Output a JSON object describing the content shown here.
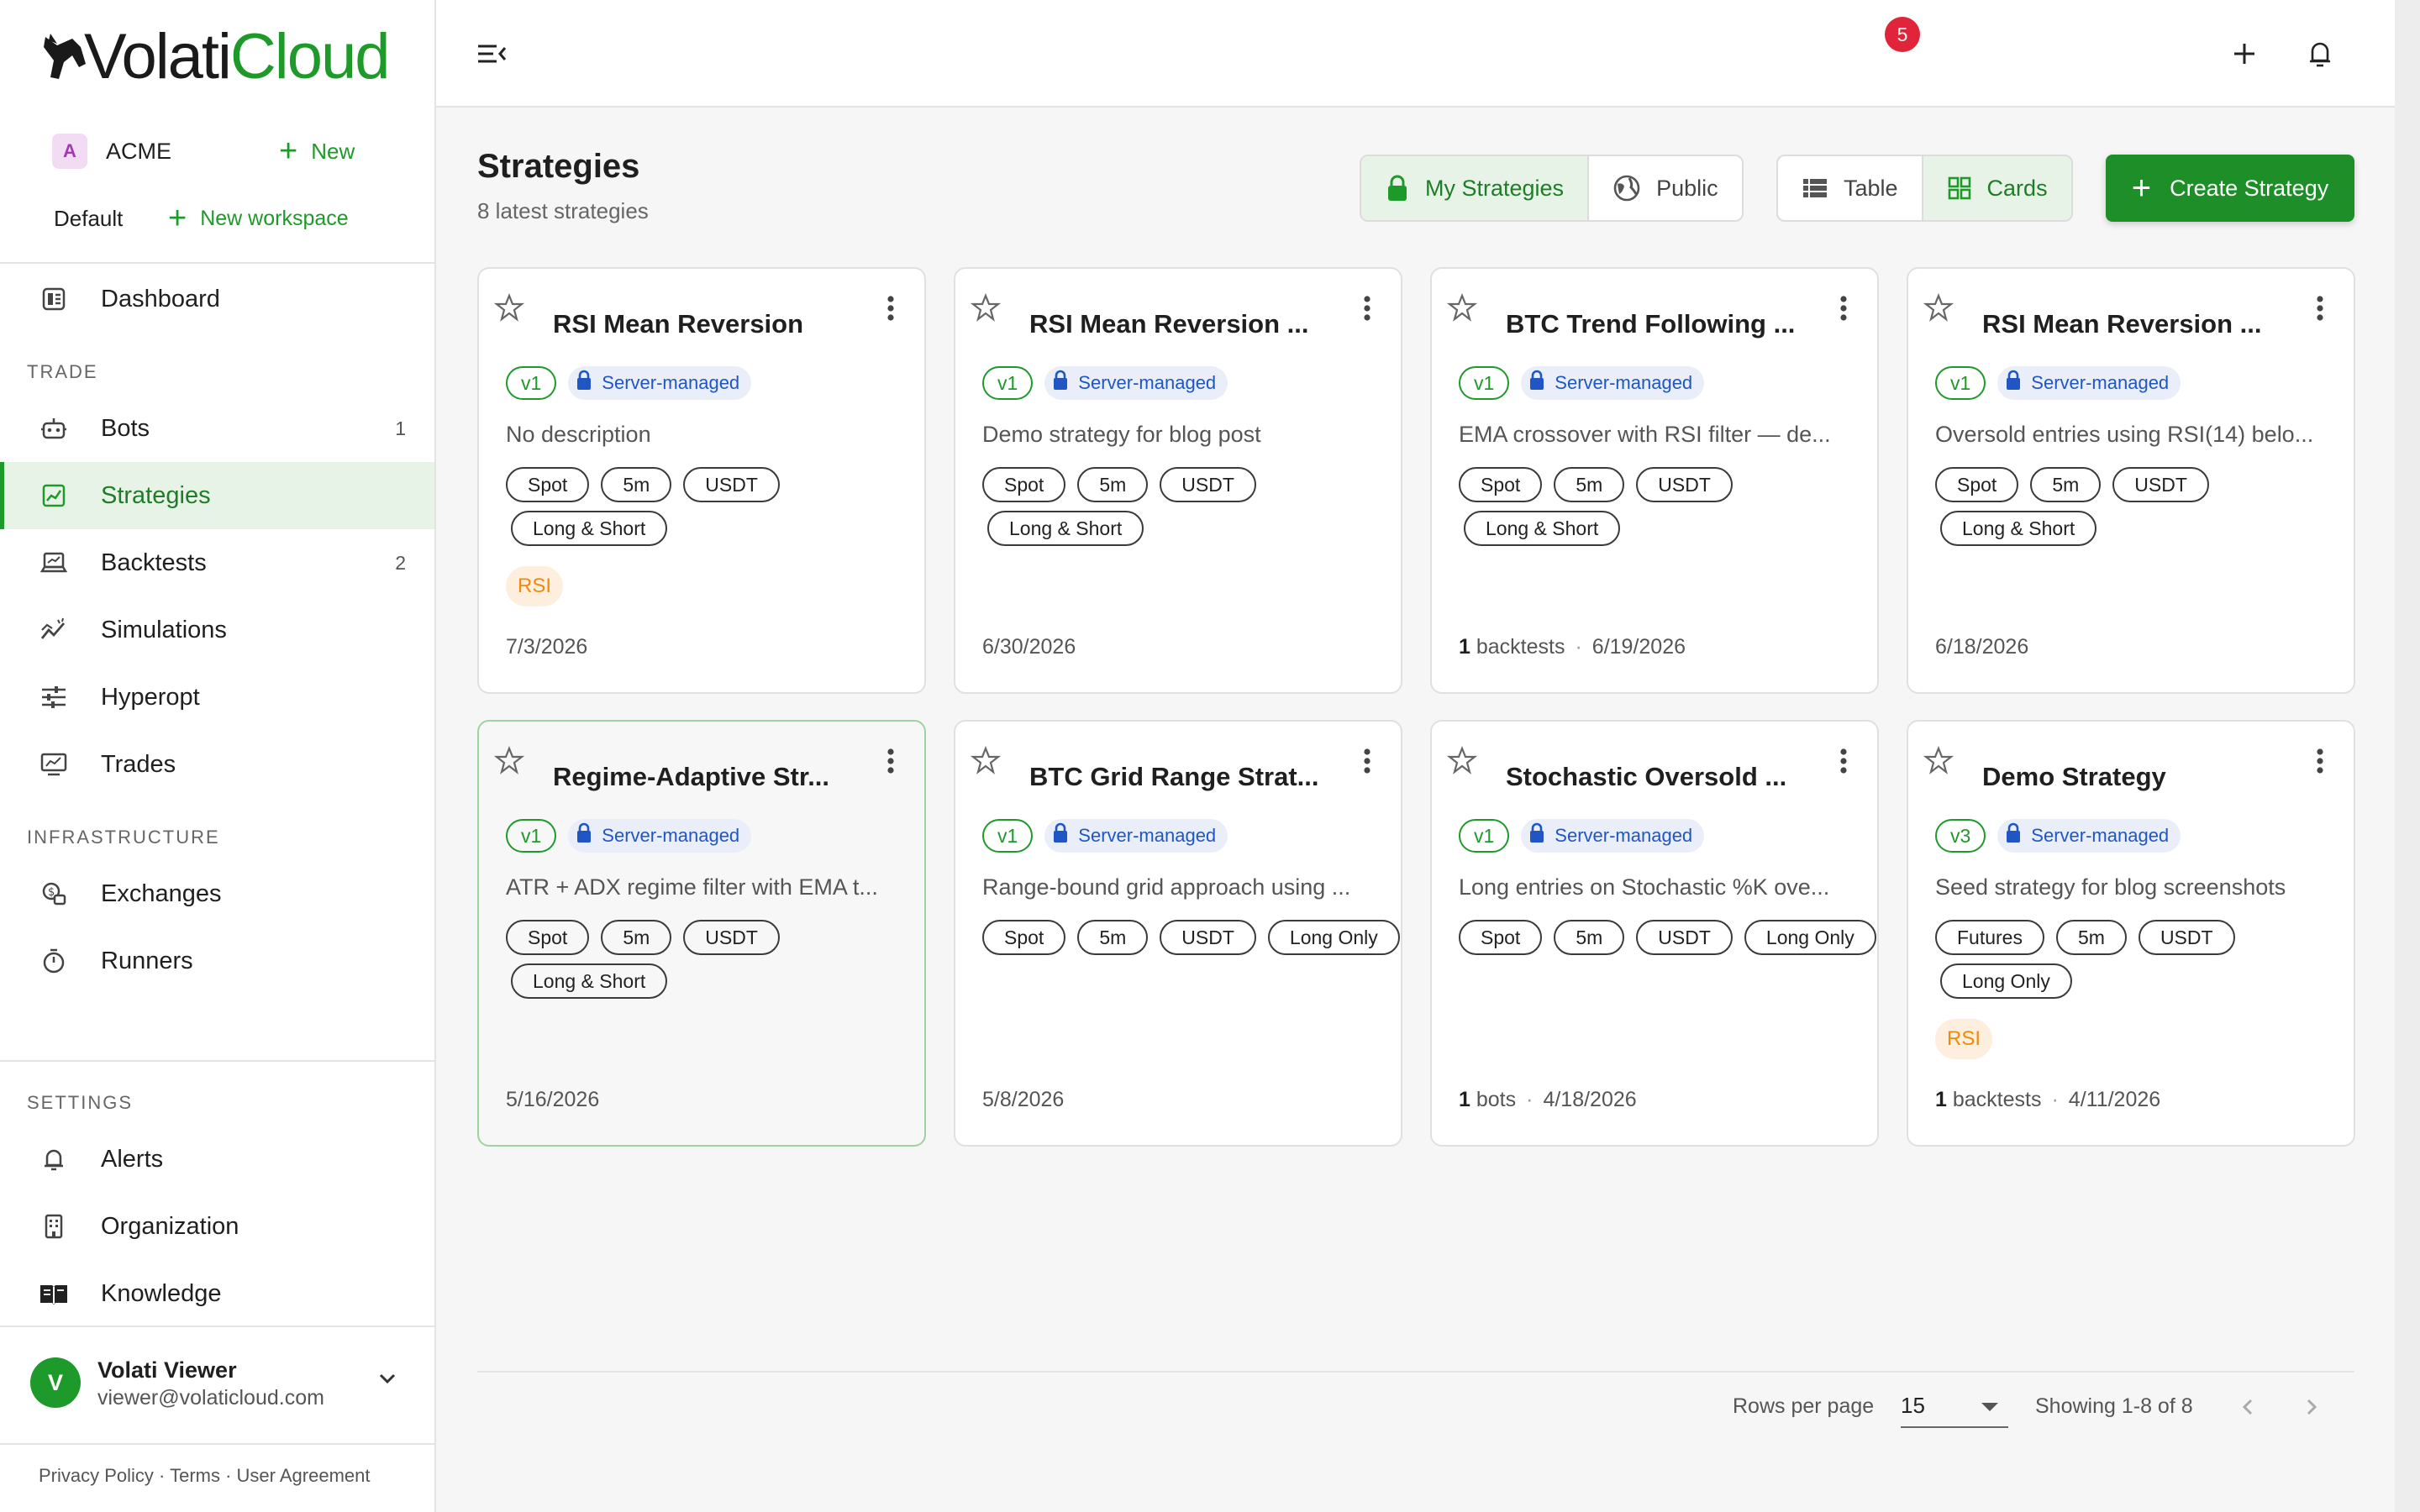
{
  "app": {
    "logo_main": "Volati",
    "logo_accent": "Cloud"
  },
  "sidebar": {
    "org": {
      "badge": "A",
      "name": "ACME",
      "new_label": "New"
    },
    "workspace": {
      "name": "Default",
      "new_label": "New workspace"
    },
    "dashboard_label": "Dashboard",
    "sections": {
      "trade": "TRADE",
      "infrastructure": "INFRASTRUCTURE",
      "settings": "SETTINGS"
    },
    "trade_items": [
      {
        "label": "Bots",
        "count": "1",
        "icon": "bot-icon"
      },
      {
        "label": "Strategies",
        "count": "",
        "icon": "strategy-icon",
        "active": true
      },
      {
        "label": "Backtests",
        "count": "2",
        "icon": "backtest-icon"
      },
      {
        "label": "Simulations",
        "count": "",
        "icon": "simulation-icon"
      },
      {
        "label": "Hyperopt",
        "count": "",
        "icon": "tune-icon"
      },
      {
        "label": "Trades",
        "count": "",
        "icon": "chart-icon"
      }
    ],
    "infra_items": [
      {
        "label": "Exchanges",
        "icon": "exchange-icon"
      },
      {
        "label": "Runners",
        "icon": "timer-icon"
      }
    ],
    "settings_items": [
      {
        "label": "Alerts",
        "icon": "bell-icon"
      },
      {
        "label": "Organization",
        "icon": "building-icon"
      },
      {
        "label": "Knowledge",
        "icon": "book-icon"
      }
    ],
    "user": {
      "initial": "V",
      "name": "Volati Viewer",
      "email": "viewer@volaticloud.com"
    },
    "footer": {
      "privacy": "Privacy Policy",
      "terms": "Terms",
      "agreement": "User Agreement",
      "sep": " · "
    }
  },
  "topbar": {
    "notification_count": "5"
  },
  "page": {
    "title": "Strategies",
    "subtitle": "8 latest strategies",
    "filter": {
      "mine": "My Strategies",
      "public": "Public"
    },
    "view": {
      "table": "Table",
      "cards": "Cards"
    },
    "create_label": "Create Strategy"
  },
  "strategies": [
    {
      "title": "RSI Mean Reversion",
      "version": "v1",
      "managed": "Server-managed",
      "description": "No description",
      "tags": [
        "Spot",
        "5m",
        "USDT",
        "Long & Short"
      ],
      "indicator": "RSI",
      "footer_count": "",
      "footer_unit": "",
      "date": "7/3/2026"
    },
    {
      "title": "RSI Mean Reversion ...",
      "version": "v1",
      "managed": "Server-managed",
      "description": "Demo strategy for blog post",
      "tags": [
        "Spot",
        "5m",
        "USDT",
        "Long & Short"
      ],
      "indicator": "",
      "footer_count": "",
      "footer_unit": "",
      "date": "6/30/2026"
    },
    {
      "title": "BTC Trend Following ...",
      "version": "v1",
      "managed": "Server-managed",
      "description": "EMA crossover with RSI filter — de...",
      "tags": [
        "Spot",
        "5m",
        "USDT",
        "Long & Short"
      ],
      "indicator": "",
      "footer_count": "1",
      "footer_unit": "backtests",
      "date": "6/19/2026"
    },
    {
      "title": "RSI Mean Reversion ...",
      "version": "v1",
      "managed": "Server-managed",
      "description": "Oversold entries using RSI(14) belo...",
      "tags": [
        "Spot",
        "5m",
        "USDT",
        "Long & Short"
      ],
      "indicator": "",
      "footer_count": "",
      "footer_unit": "",
      "date": "6/18/2026"
    },
    {
      "title": "Regime-Adaptive Str...",
      "version": "v1",
      "managed": "Server-managed",
      "description": "ATR + ADX regime filter with EMA t...",
      "tags": [
        "Spot",
        "5m",
        "USDT",
        "Long & Short"
      ],
      "indicator": "",
      "footer_count": "",
      "footer_unit": "",
      "date": "5/16/2026"
    },
    {
      "title": "BTC Grid Range Strat...",
      "version": "v1",
      "managed": "Server-managed",
      "description": "Range-bound grid approach using ...",
      "tags": [
        "Spot",
        "5m",
        "USDT",
        "Long Only"
      ],
      "indicator": "",
      "footer_count": "",
      "footer_unit": "",
      "date": "5/8/2026"
    },
    {
      "title": "Stochastic Oversold ...",
      "version": "v1",
      "managed": "Server-managed",
      "description": "Long entries on Stochastic %K ove...",
      "tags": [
        "Spot",
        "5m",
        "USDT",
        "Long Only"
      ],
      "indicator": "",
      "footer_count": "1",
      "footer_unit": "bots",
      "date": "4/18/2026"
    },
    {
      "title": "Demo Strategy",
      "version": "v3",
      "managed": "Server-managed",
      "description": "Seed strategy for blog screenshots",
      "tags": [
        "Futures",
        "5m",
        "USDT",
        "Long Only"
      ],
      "indicator": "RSI",
      "footer_count": "1",
      "footer_unit": "backtests",
      "date": "4/11/2026"
    }
  ],
  "pagination": {
    "rows_label": "Rows per page",
    "rows_value": "15",
    "showing": "Showing 1-8 of 8"
  },
  "colors": {
    "accent": "#1e9a2a",
    "managed_text": "#1f56c4",
    "indicator": "#ef8a0c",
    "badge": "#e0243a"
  }
}
